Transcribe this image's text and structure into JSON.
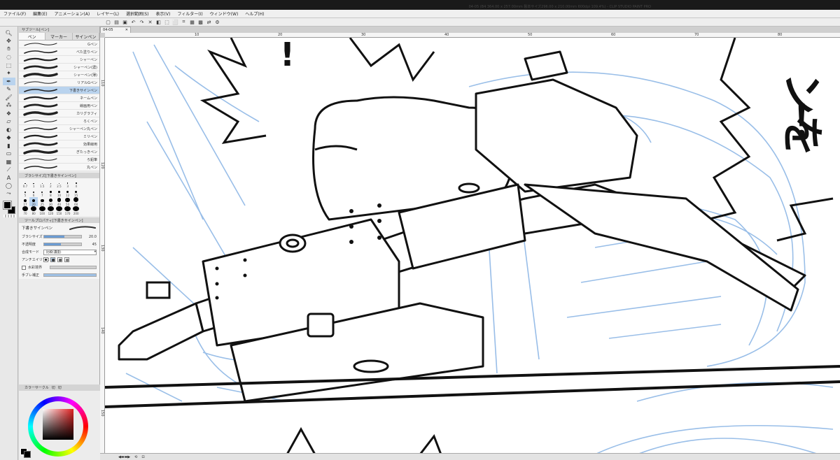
{
  "menu": [
    "ファイル(F)",
    "編集(E)",
    "アニメーション(A)",
    "レイヤー(L)",
    "選択範囲(S)",
    "表示(V)",
    "フィルター(I)",
    "ウィンドウ(W)",
    "ヘルプ(H)"
  ],
  "document_title": "04-05 (B4 364.00 x 257.00mm 製本サイズ296.00 x 210.00mm 600dpi 109.4%) - CLIP STUDIO PAINT PRO",
  "subtool_panel": {
    "header": "サブツール[ペン]",
    "tabs": [
      "ペン",
      "マーカー",
      "サインペン"
    ],
    "brushes": [
      "Gペン",
      "べた塗りペン",
      "シャーペン",
      "シャーペン(濃)",
      "シャーペン(薄)",
      "リアルGペン",
      "下書きサインペン",
      "ネームペン",
      "線画用ペン",
      "カリグラフィ",
      "ろくペン",
      "シャーペン丸ペン",
      "ミリペン",
      "効果線用",
      "ぎたっきペン",
      "ろ鉛筆",
      "丸ペン"
    ],
    "active_brush": "下書きサインペン"
  },
  "brush_size_panel": {
    "header": "ブラシサイズ[下書きサインペン]",
    "sizes": [
      "0.7",
      "1",
      "1.5",
      "2",
      "2.5",
      "3",
      "4",
      "",
      "",
      "5",
      "6",
      "7",
      "8",
      "10",
      "12",
      "15",
      "",
      "",
      "17",
      "20",
      "25",
      "30",
      "40",
      "50",
      "60",
      "",
      "",
      "70",
      "80",
      "100",
      "120",
      "150",
      "170",
      "200",
      "",
      ""
    ],
    "active_size": "20"
  },
  "tool_property": {
    "header": "ツールプロパティ[下書きサインペン]",
    "title": "下書きサインペン",
    "brush_size_label": "ブラシサイズ",
    "brush_size_value": "20.0",
    "brush_size_fraction": 0.55,
    "opacity_label": "不透明度",
    "opacity_value": "45",
    "opacity_fraction": 0.45,
    "blend_label": "合成モード",
    "blend_value": "比較(濃度)",
    "aa_label": "アンチエイリアス",
    "edge_label": "水彩境界",
    "stabilizer_label": "手ブレ補正"
  },
  "color_panel": {
    "tabs": [
      "カラーサークル",
      "切",
      "切"
    ],
    "main_color": "#000000"
  },
  "canvas": {
    "tab_label": "04-05",
    "ruler_h": [
      "10",
      "20",
      "30",
      "40",
      "50",
      "60",
      "70",
      "80",
      "90"
    ],
    "ruler_v": [
      "110",
      "120",
      "130",
      "140",
      "150"
    ],
    "text_chars": [
      "ンを",
      "！"
    ]
  },
  "colors": {
    "selection": "#b9d3ee",
    "sketch_blue": "#8fb8e6",
    "ink": "#111111"
  }
}
